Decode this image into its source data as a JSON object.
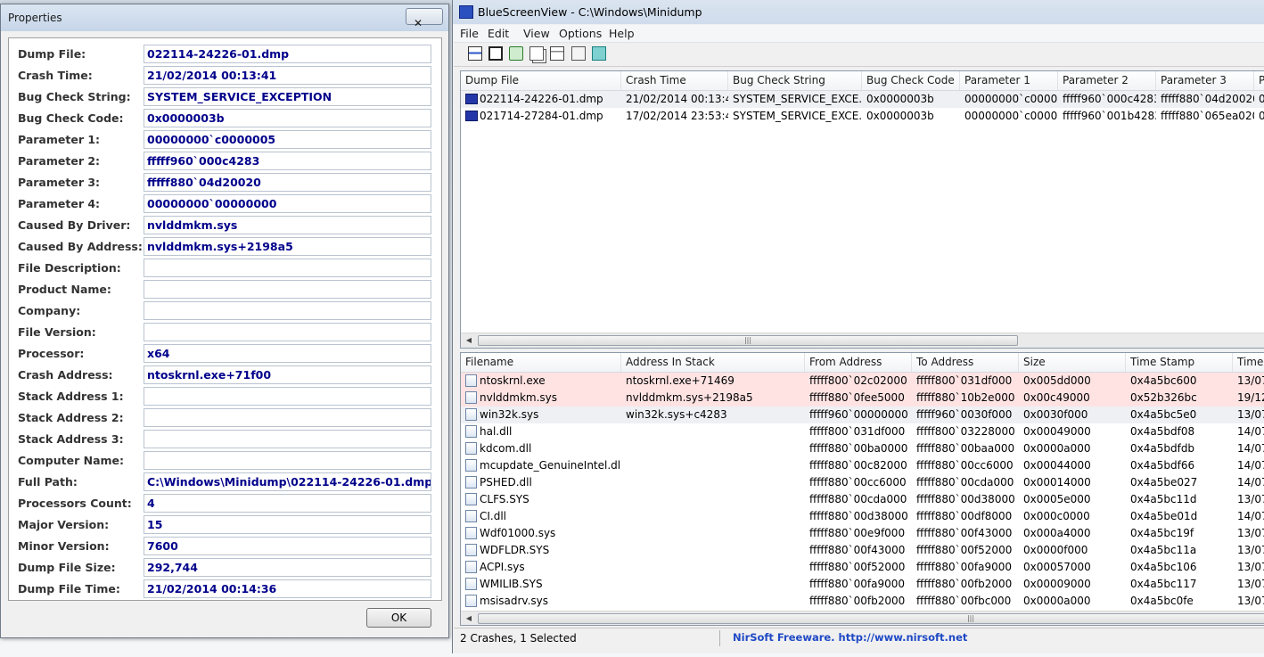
{
  "properties": {
    "title": "Properties",
    "close_symbol": "✕",
    "ok_label": "OK",
    "fields": [
      {
        "label": "Dump File:",
        "value": "022114-24226-01.dmp"
      },
      {
        "label": "Crash Time:",
        "value": "21/02/2014 00:13:41"
      },
      {
        "label": "Bug Check String:",
        "value": "SYSTEM_SERVICE_EXCEPTION"
      },
      {
        "label": "Bug Check Code:",
        "value": "0x0000003b"
      },
      {
        "label": "Parameter 1:",
        "value": "00000000`c0000005"
      },
      {
        "label": "Parameter 2:",
        "value": "fffff960`000c4283"
      },
      {
        "label": "Parameter 3:",
        "value": "fffff880`04d20020"
      },
      {
        "label": "Parameter 4:",
        "value": "00000000`00000000"
      },
      {
        "label": "Caused By Driver:",
        "value": "nvlddmkm.sys"
      },
      {
        "label": "Caused By Address:",
        "value": "nvlddmkm.sys+2198a5"
      },
      {
        "label": "File Description:",
        "value": ""
      },
      {
        "label": "Product Name:",
        "value": ""
      },
      {
        "label": "Company:",
        "value": ""
      },
      {
        "label": "File Version:",
        "value": ""
      },
      {
        "label": "Processor:",
        "value": "x64"
      },
      {
        "label": "Crash Address:",
        "value": "ntoskrnl.exe+71f00"
      },
      {
        "label": "Stack Address 1:",
        "value": ""
      },
      {
        "label": "Stack Address 2:",
        "value": ""
      },
      {
        "label": "Stack Address 3:",
        "value": ""
      },
      {
        "label": "Computer Name:",
        "value": ""
      },
      {
        "label": "Full Path:",
        "value": "C:\\Windows\\Minidump\\022114-24226-01.dmp"
      },
      {
        "label": "Processors Count:",
        "value": "4"
      },
      {
        "label": "Major Version:",
        "value": "15"
      },
      {
        "label": "Minor Version:",
        "value": "7600"
      },
      {
        "label": "Dump File Size:",
        "value": "292,744"
      },
      {
        "label": "Dump File Time:",
        "value": "21/02/2014 00:14:36"
      }
    ]
  },
  "window": {
    "title": "BlueScreenView  -  C:\\Windows\\Minidump",
    "menu": [
      "File",
      "Edit",
      "View",
      "Options",
      "Help"
    ],
    "toolbar_icons": [
      "html-report-icon",
      "save-icon",
      "refresh-icon",
      "copy-icon",
      "properties-icon",
      "find-icon",
      "exit-icon"
    ]
  },
  "crash_list": {
    "columns": [
      "Dump File",
      "Crash Time",
      "Bug Check String",
      "Bug Check Code",
      "Parameter 1",
      "Parameter 2",
      "Parameter 3",
      "P"
    ],
    "rows": [
      [
        "022114-24226-01.dmp",
        "21/02/2014 00:13:41",
        "SYSTEM_SERVICE_EXCE...",
        "0x0000003b",
        "00000000`c00000...",
        "fffff960`000c4283",
        "fffff880`04d20020",
        "00"
      ],
      [
        "021714-27284-01.dmp",
        "17/02/2014 23:53:48",
        "SYSTEM_SERVICE_EXCE...",
        "0x0000003b",
        "00000000`c00000...",
        "fffff960`001b4283",
        "fffff880`065ea020",
        "00"
      ]
    ],
    "scroll_grip": "|||"
  },
  "driver_list": {
    "columns": [
      "Filename",
      "Address In Stack",
      "From Address",
      "To Address",
      "Size",
      "Time Stamp",
      "Time"
    ],
    "rows": [
      [
        "ntoskrnl.exe",
        "ntoskrnl.exe+71469",
        "fffff800`02c02000",
        "fffff800`031df000",
        "0x005dd000",
        "0x4a5bc600",
        "13/07,"
      ],
      [
        "nvlddmkm.sys",
        "nvlddmkm.sys+2198a5",
        "fffff880`0fee5000",
        "fffff880`10b2e000",
        "0x00c49000",
        "0x52b326bc",
        "19/12,"
      ],
      [
        "win32k.sys",
        "win32k.sys+c4283",
        "fffff960`00000000",
        "fffff960`0030f000",
        "0x0030f000",
        "0x4a5bc5e0",
        "13/07,"
      ],
      [
        "hal.dll",
        "",
        "fffff800`031df000",
        "fffff800`03228000",
        "0x00049000",
        "0x4a5bdf08",
        "14/07,"
      ],
      [
        "kdcom.dll",
        "",
        "fffff880`00ba0000",
        "fffff880`00baa000",
        "0x0000a000",
        "0x4a5bdfdb",
        "14/07,"
      ],
      [
        "mcupdate_GenuineIntel.dll",
        "",
        "fffff880`00c82000",
        "fffff880`00cc6000",
        "0x00044000",
        "0x4a5bdf66",
        "14/07,"
      ],
      [
        "PSHED.dll",
        "",
        "fffff880`00cc6000",
        "fffff880`00cda000",
        "0x00014000",
        "0x4a5be027",
        "14/07,"
      ],
      [
        "CLFS.SYS",
        "",
        "fffff880`00cda000",
        "fffff880`00d38000",
        "0x0005e000",
        "0x4a5bc11d",
        "13/07,"
      ],
      [
        "CI.dll",
        "",
        "fffff880`00d38000",
        "fffff880`00df8000",
        "0x000c0000",
        "0x4a5be01d",
        "14/07,"
      ],
      [
        "Wdf01000.sys",
        "",
        "fffff880`00e9f000",
        "fffff880`00f43000",
        "0x000a4000",
        "0x4a5bc19f",
        "13/07,"
      ],
      [
        "WDFLDR.SYS",
        "",
        "fffff880`00f43000",
        "fffff880`00f52000",
        "0x0000f000",
        "0x4a5bc11a",
        "13/07,"
      ],
      [
        "ACPI.sys",
        "",
        "fffff880`00f52000",
        "fffff880`00fa9000",
        "0x00057000",
        "0x4a5bc106",
        "13/07,"
      ],
      [
        "WMILIB.SYS",
        "",
        "fffff880`00fa9000",
        "fffff880`00fb2000",
        "0x00009000",
        "0x4a5bc117",
        "13/07,"
      ],
      [
        "msisadrv.sys",
        "",
        "fffff880`00fb2000",
        "fffff880`00fbc000",
        "0x0000a000",
        "0x4a5bc0fe",
        "13/07,"
      ]
    ],
    "scroll_grip": "|||"
  },
  "status": {
    "count": "2 Crashes, 1 Selected",
    "link": "NirSoft Freeware.  http://www.nirsoft.net"
  },
  "colors": {
    "highlight_row": "#ffe3e3",
    "selected_row": "#eef0f3",
    "value_text": "#00008b",
    "link_text": "#1f49c5"
  }
}
